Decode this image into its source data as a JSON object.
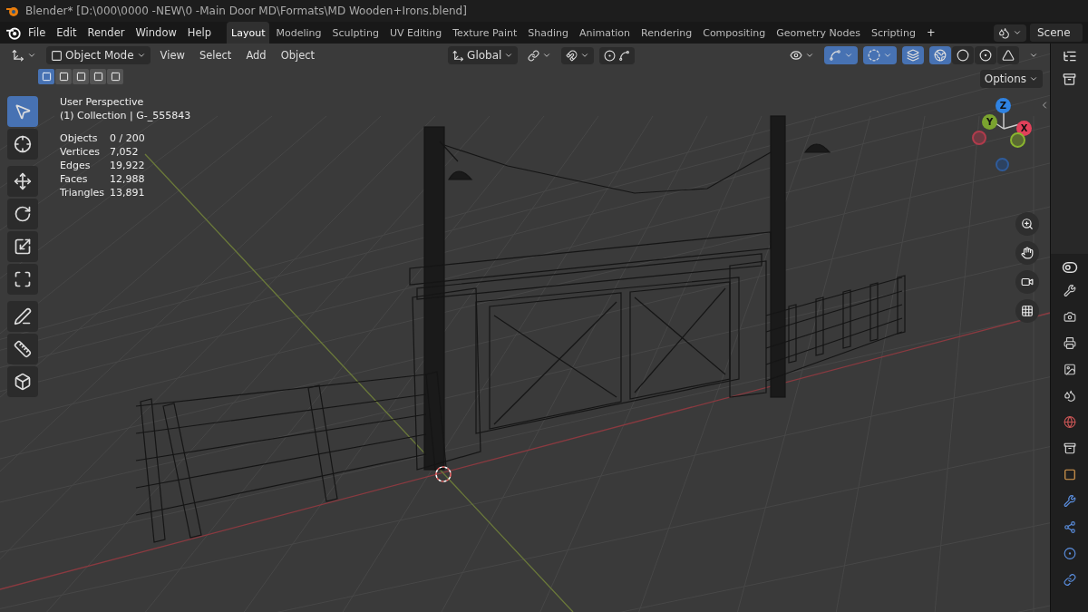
{
  "window": {
    "title": "Blender* [D:\\000\\0000 -NEW\\0 -Main Door MD\\Formats\\MD Wooden+Irons.blend]"
  },
  "menu": [
    "File",
    "Edit",
    "Render",
    "Window",
    "Help"
  ],
  "workspaces": [
    {
      "label": "Layout",
      "selected": true
    },
    {
      "label": "Modeling",
      "selected": false
    },
    {
      "label": "Sculpting",
      "selected": false
    },
    {
      "label": "UV Editing",
      "selected": false
    },
    {
      "label": "Texture Paint",
      "selected": false
    },
    {
      "label": "Shading",
      "selected": false
    },
    {
      "label": "Animation",
      "selected": false
    },
    {
      "label": "Rendering",
      "selected": false
    },
    {
      "label": "Compositing",
      "selected": false
    },
    {
      "label": "Geometry Nodes",
      "selected": false
    },
    {
      "label": "Scripting",
      "selected": false
    }
  ],
  "add_workspace": "+",
  "scene": "Scene",
  "header": {
    "mode": "Object Mode",
    "menus": [
      "View",
      "Select",
      "Add",
      "Object"
    ],
    "orientation": "Global",
    "options": "Options",
    "select_modes": [
      {
        "selected": true
      },
      {
        "selected": false
      },
      {
        "selected": false
      },
      {
        "selected": false
      },
      {
        "selected": false
      }
    ],
    "toggles": [
      {
        "kind": "visibility",
        "on": false
      },
      {
        "kind": "gizmo",
        "on": true
      },
      {
        "kind": "overlay",
        "on": true
      },
      {
        "kind": "xray",
        "on": true
      }
    ],
    "shading": [
      {
        "kind": "wireframe",
        "selected": true
      },
      {
        "kind": "solid",
        "selected": false
      },
      {
        "kind": "material",
        "selected": false
      },
      {
        "kind": "rendered",
        "selected": false
      }
    ]
  },
  "overlay": {
    "view": "User Perspective",
    "collection": "(1) Collection | G-_555843"
  },
  "stats": [
    {
      "label": "Objects",
      "value": "0 / 200"
    },
    {
      "label": "Vertices",
      "value": "7,052"
    },
    {
      "label": "Edges",
      "value": "19,922"
    },
    {
      "label": "Faces",
      "value": "12,988"
    },
    {
      "label": "Triangles",
      "value": "13,891"
    }
  ],
  "tools": [
    {
      "kind": "select",
      "selected": true
    },
    {
      "kind": "cursor",
      "selected": false
    },
    {
      "kind": "move",
      "selected": false
    },
    {
      "kind": "rotate",
      "selected": false
    },
    {
      "kind": "scale",
      "selected": false
    },
    {
      "kind": "transform",
      "selected": false
    },
    {
      "kind": "annotate",
      "selected": false
    },
    {
      "kind": "measure",
      "selected": false
    },
    {
      "kind": "add-cube",
      "selected": false
    }
  ],
  "gizmo": {
    "axes": [
      "Z",
      "Y",
      "X"
    ]
  },
  "properties_tabs": [
    {
      "kind": "tool"
    },
    {
      "kind": "render"
    },
    {
      "kind": "output"
    },
    {
      "kind": "view-layer"
    },
    {
      "kind": "scene"
    },
    {
      "kind": "world"
    },
    {
      "kind": "collection"
    },
    {
      "kind": "object"
    },
    {
      "kind": "modifier"
    },
    {
      "kind": "particles"
    },
    {
      "kind": "physics"
    },
    {
      "kind": "constraints"
    }
  ]
}
